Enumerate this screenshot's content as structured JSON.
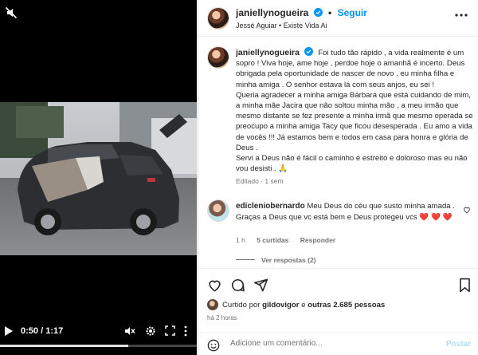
{
  "post": {
    "username": "janiellynogueira",
    "follow_label": "Seguir",
    "separator": "•",
    "audio": "Jessé Aguiar • Existe Vida Ai",
    "caption_lines": [
      "Foi tudo tão rápido , a vida realmente é um sopro ! Viva hoje, ame hoje , perdoe hoje o amanhã é incerto.",
      "Deus obrigada pela oportunidade de nascer de novo , eu minha filha e minha amiga . O senhor estava lá com seus anjos, eu sei !",
      "Queria agradecer a minha amiga Bárbara que está cuidando de mim, a minha mãe Jacira que não soltou minha mão , a meu irmão que mesmo distante se fez presente a minha irmã que mesmo operada se preocupo a minha amiga Tacy que ficou desesperada . Eu amo a vida de vocês !!! Já estamos bem e todos em casa para honra e glória de Deus .",
      "Servi a Deus não é fácil o caminho é estreito e doloroso mas eu não vou desisti . 🙏"
    ],
    "edited_label": "Editado",
    "edited_time": "1 sem"
  },
  "comment": {
    "username": "edicleniobernardo",
    "text": "Meu Deus do céu que susto minha amada . Graças a Deus que vc está bem e Deus protegeu vcs",
    "hearts": "❤️ ❤️ ❤️",
    "time": "1 h",
    "likes": "5 curtidas",
    "reply": "Responder",
    "view_replies": "Ver respostas (2)"
  },
  "likes": {
    "prefix": "Curtido por",
    "user": "gildovigor",
    "middle": "e",
    "others": "outras 2.685 pessoas"
  },
  "time_ago": "há 2 horas",
  "add_comment": {
    "placeholder": "Adicione um comentário...",
    "post_label": "Postar"
  },
  "video": {
    "current_time": "0:50",
    "duration": "1:17",
    "time_separator": " / ",
    "progress_fraction": 0.65
  },
  "colors": {
    "accent": "#0095f6",
    "heart": "#ed4956",
    "muted_text": "#737373"
  },
  "icons": [
    "mute-icon",
    "play-icon",
    "volume-mute-icon",
    "gear-icon",
    "fullscreen-icon",
    "more-vertical-icon",
    "verified-icon",
    "more-icon",
    "heart-icon",
    "comment-icon",
    "share-icon",
    "save-icon",
    "emoji-icon"
  ]
}
